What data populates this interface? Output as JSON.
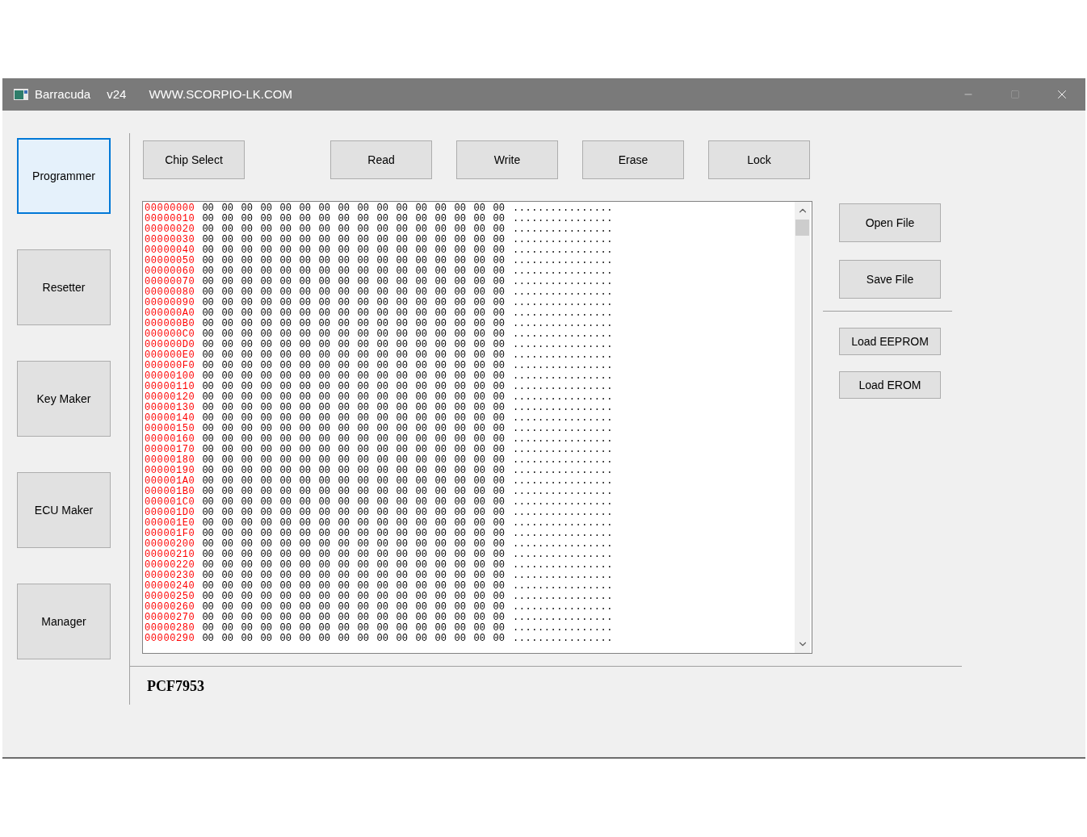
{
  "window": {
    "title": "Barracuda",
    "version": "v24",
    "site": "WWW.SCORPIO-LK.COM"
  },
  "nav": [
    {
      "label": "Programmer",
      "selected": true
    },
    {
      "label": "Resetter",
      "selected": false
    },
    {
      "label": "Key Maker",
      "selected": false
    },
    {
      "label": "ECU Maker",
      "selected": false
    },
    {
      "label": "Manager",
      "selected": false
    }
  ],
  "toolbar": [
    "Chip Select",
    "Read",
    "Write",
    "Erase",
    "Lock"
  ],
  "hex_rows": [
    {
      "address": "00000000",
      "bytes": "00 00 00 00 00 00 00 00 00 00 00 00 00 00 00 00",
      "ascii": "................"
    },
    {
      "address": "00000010",
      "bytes": "00 00 00 00 00 00 00 00 00 00 00 00 00 00 00 00",
      "ascii": "................"
    },
    {
      "address": "00000020",
      "bytes": "00 00 00 00 00 00 00 00 00 00 00 00 00 00 00 00",
      "ascii": "................"
    },
    {
      "address": "00000030",
      "bytes": "00 00 00 00 00 00 00 00 00 00 00 00 00 00 00 00",
      "ascii": "................"
    },
    {
      "address": "00000040",
      "bytes": "00 00 00 00 00 00 00 00 00 00 00 00 00 00 00 00",
      "ascii": "................"
    },
    {
      "address": "00000050",
      "bytes": "00 00 00 00 00 00 00 00 00 00 00 00 00 00 00 00",
      "ascii": "................"
    },
    {
      "address": "00000060",
      "bytes": "00 00 00 00 00 00 00 00 00 00 00 00 00 00 00 00",
      "ascii": "................"
    },
    {
      "address": "00000070",
      "bytes": "00 00 00 00 00 00 00 00 00 00 00 00 00 00 00 00",
      "ascii": "................"
    },
    {
      "address": "00000080",
      "bytes": "00 00 00 00 00 00 00 00 00 00 00 00 00 00 00 00",
      "ascii": "................"
    },
    {
      "address": "00000090",
      "bytes": "00 00 00 00 00 00 00 00 00 00 00 00 00 00 00 00",
      "ascii": "................"
    },
    {
      "address": "000000A0",
      "bytes": "00 00 00 00 00 00 00 00 00 00 00 00 00 00 00 00",
      "ascii": "................"
    },
    {
      "address": "000000B0",
      "bytes": "00 00 00 00 00 00 00 00 00 00 00 00 00 00 00 00",
      "ascii": "................"
    },
    {
      "address": "000000C0",
      "bytes": "00 00 00 00 00 00 00 00 00 00 00 00 00 00 00 00",
      "ascii": "................"
    },
    {
      "address": "000000D0",
      "bytes": "00 00 00 00 00 00 00 00 00 00 00 00 00 00 00 00",
      "ascii": "................"
    },
    {
      "address": "000000E0",
      "bytes": "00 00 00 00 00 00 00 00 00 00 00 00 00 00 00 00",
      "ascii": "................"
    },
    {
      "address": "000000F0",
      "bytes": "00 00 00 00 00 00 00 00 00 00 00 00 00 00 00 00",
      "ascii": "................"
    },
    {
      "address": "00000100",
      "bytes": "00 00 00 00 00 00 00 00 00 00 00 00 00 00 00 00",
      "ascii": "................"
    },
    {
      "address": "00000110",
      "bytes": "00 00 00 00 00 00 00 00 00 00 00 00 00 00 00 00",
      "ascii": "................"
    },
    {
      "address": "00000120",
      "bytes": "00 00 00 00 00 00 00 00 00 00 00 00 00 00 00 00",
      "ascii": "................"
    },
    {
      "address": "00000130",
      "bytes": "00 00 00 00 00 00 00 00 00 00 00 00 00 00 00 00",
      "ascii": "................"
    },
    {
      "address": "00000140",
      "bytes": "00 00 00 00 00 00 00 00 00 00 00 00 00 00 00 00",
      "ascii": "................"
    },
    {
      "address": "00000150",
      "bytes": "00 00 00 00 00 00 00 00 00 00 00 00 00 00 00 00",
      "ascii": "................"
    },
    {
      "address": "00000160",
      "bytes": "00 00 00 00 00 00 00 00 00 00 00 00 00 00 00 00",
      "ascii": "................"
    },
    {
      "address": "00000170",
      "bytes": "00 00 00 00 00 00 00 00 00 00 00 00 00 00 00 00",
      "ascii": "................"
    },
    {
      "address": "00000180",
      "bytes": "00 00 00 00 00 00 00 00 00 00 00 00 00 00 00 00",
      "ascii": "................"
    },
    {
      "address": "00000190",
      "bytes": "00 00 00 00 00 00 00 00 00 00 00 00 00 00 00 00",
      "ascii": "................"
    },
    {
      "address": "000001A0",
      "bytes": "00 00 00 00 00 00 00 00 00 00 00 00 00 00 00 00",
      "ascii": "................"
    },
    {
      "address": "000001B0",
      "bytes": "00 00 00 00 00 00 00 00 00 00 00 00 00 00 00 00",
      "ascii": "................"
    },
    {
      "address": "000001C0",
      "bytes": "00 00 00 00 00 00 00 00 00 00 00 00 00 00 00 00",
      "ascii": "................"
    },
    {
      "address": "000001D0",
      "bytes": "00 00 00 00 00 00 00 00 00 00 00 00 00 00 00 00",
      "ascii": "................"
    },
    {
      "address": "000001E0",
      "bytes": "00 00 00 00 00 00 00 00 00 00 00 00 00 00 00 00",
      "ascii": "................"
    },
    {
      "address": "000001F0",
      "bytes": "00 00 00 00 00 00 00 00 00 00 00 00 00 00 00 00",
      "ascii": "................"
    },
    {
      "address": "00000200",
      "bytes": "00 00 00 00 00 00 00 00 00 00 00 00 00 00 00 00",
      "ascii": "................"
    },
    {
      "address": "00000210",
      "bytes": "00 00 00 00 00 00 00 00 00 00 00 00 00 00 00 00",
      "ascii": "................"
    },
    {
      "address": "00000220",
      "bytes": "00 00 00 00 00 00 00 00 00 00 00 00 00 00 00 00",
      "ascii": "................"
    },
    {
      "address": "00000230",
      "bytes": "00 00 00 00 00 00 00 00 00 00 00 00 00 00 00 00",
      "ascii": "................"
    },
    {
      "address": "00000240",
      "bytes": "00 00 00 00 00 00 00 00 00 00 00 00 00 00 00 00",
      "ascii": "................"
    },
    {
      "address": "00000250",
      "bytes": "00 00 00 00 00 00 00 00 00 00 00 00 00 00 00 00",
      "ascii": "................"
    },
    {
      "address": "00000260",
      "bytes": "00 00 00 00 00 00 00 00 00 00 00 00 00 00 00 00",
      "ascii": "................"
    },
    {
      "address": "00000270",
      "bytes": "00 00 00 00 00 00 00 00 00 00 00 00 00 00 00 00",
      "ascii": "................"
    },
    {
      "address": "00000280",
      "bytes": "00 00 00 00 00 00 00 00 00 00 00 00 00 00 00 00",
      "ascii": "................"
    },
    {
      "address": "00000290",
      "bytes": "00 00 00 00 00 00 00 00 00 00 00 00 00 00 00 00",
      "ascii": "................"
    }
  ],
  "file_buttons": [
    "Open File",
    "Save File"
  ],
  "load_buttons": [
    "Load EEPROM",
    "Load EROM"
  ],
  "status": "PCF7953"
}
